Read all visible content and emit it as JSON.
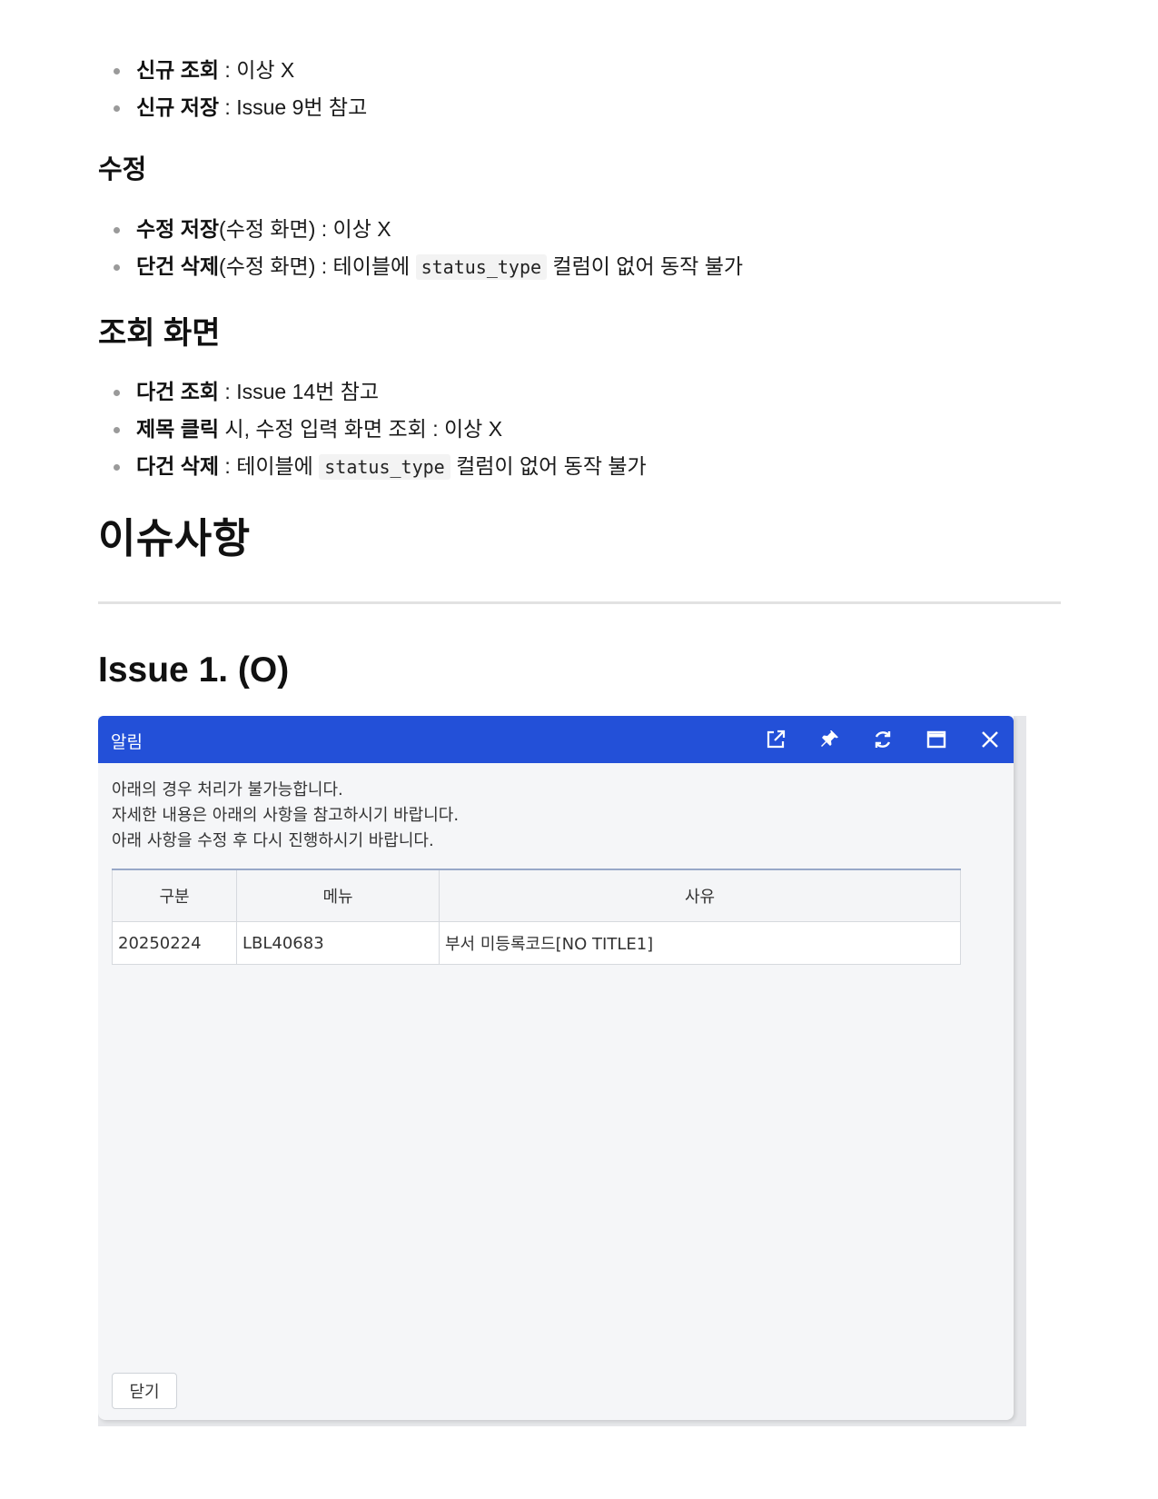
{
  "list1": [
    {
      "bold": "신규 조회",
      "text": " : 이상 X"
    },
    {
      "bold": "신규 저장",
      "text": " : Issue 9번 참고"
    }
  ],
  "heading_edit": "수정",
  "list2": [
    {
      "bold": "수정 저장",
      "text": "(수정 화면) : 이상 X"
    },
    {
      "bold": "단건 삭제",
      "text": "(수정 화면) : 테이블에 ",
      "code": "status_type",
      "after": " 컬럼이 없어 동작 불가"
    }
  ],
  "heading_view": "조회 화면",
  "list3": [
    {
      "bold": "다건 조회",
      "text": " : Issue 14번 참고"
    },
    {
      "bold": "제목 클릭",
      "text": " 시, 수정 입력 화면 조회 : 이상 X"
    },
    {
      "bold": "다건 삭제",
      "text": " : 테이블에 ",
      "code": "status_type",
      "after": " 컬럼이 없어 동작 불가"
    }
  ],
  "heading_issues": "이슈사항",
  "heading_issue1": "Issue 1. (O)",
  "dialog": {
    "title": "알림",
    "icons": [
      "external-link-icon",
      "pin-icon",
      "refresh-icon",
      "maximize-icon",
      "close-icon"
    ],
    "message": [
      "아래의 경우 처리가 불가능합니다.",
      "자세한 내용은 아래의 사항을 참고하시기 바랍니다.",
      "아래 사항을 수정 후 다시 진행하시기 바랍니다."
    ],
    "table": {
      "headers": [
        "구분",
        "메뉴",
        "사유"
      ],
      "rows": [
        [
          "20250224",
          "LBL40683",
          "부서 미등록코드[NO TITLE1]"
        ]
      ]
    },
    "close_label": "닫기",
    "accent_color": "#2350d8"
  }
}
